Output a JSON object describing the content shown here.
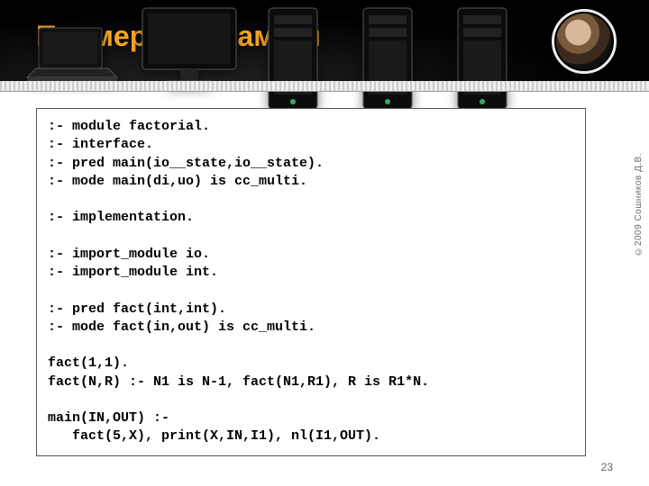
{
  "header": {
    "title": "Пример программы"
  },
  "code": {
    "text": ":- module factorial.\n:- interface.\n:- pred main(io__state,io__state).\n:- mode main(di,uo) is cc_multi.\n\n:- implementation.\n\n:- import_module io.\n:- import_module int.\n\n:- pred fact(int,int).\n:- mode fact(in,out) is cc_multi.\n\nfact(1,1).\nfact(N,R) :- N1 is N-1, fact(N1,R1), R is R1*N.\n\nmain(IN,OUT) :-\n   fact(5,X), print(X,IN,I1), nl(I1,OUT)."
  },
  "footer": {
    "page_number": "23",
    "copyright": "©2009  Сошников Д.В."
  }
}
